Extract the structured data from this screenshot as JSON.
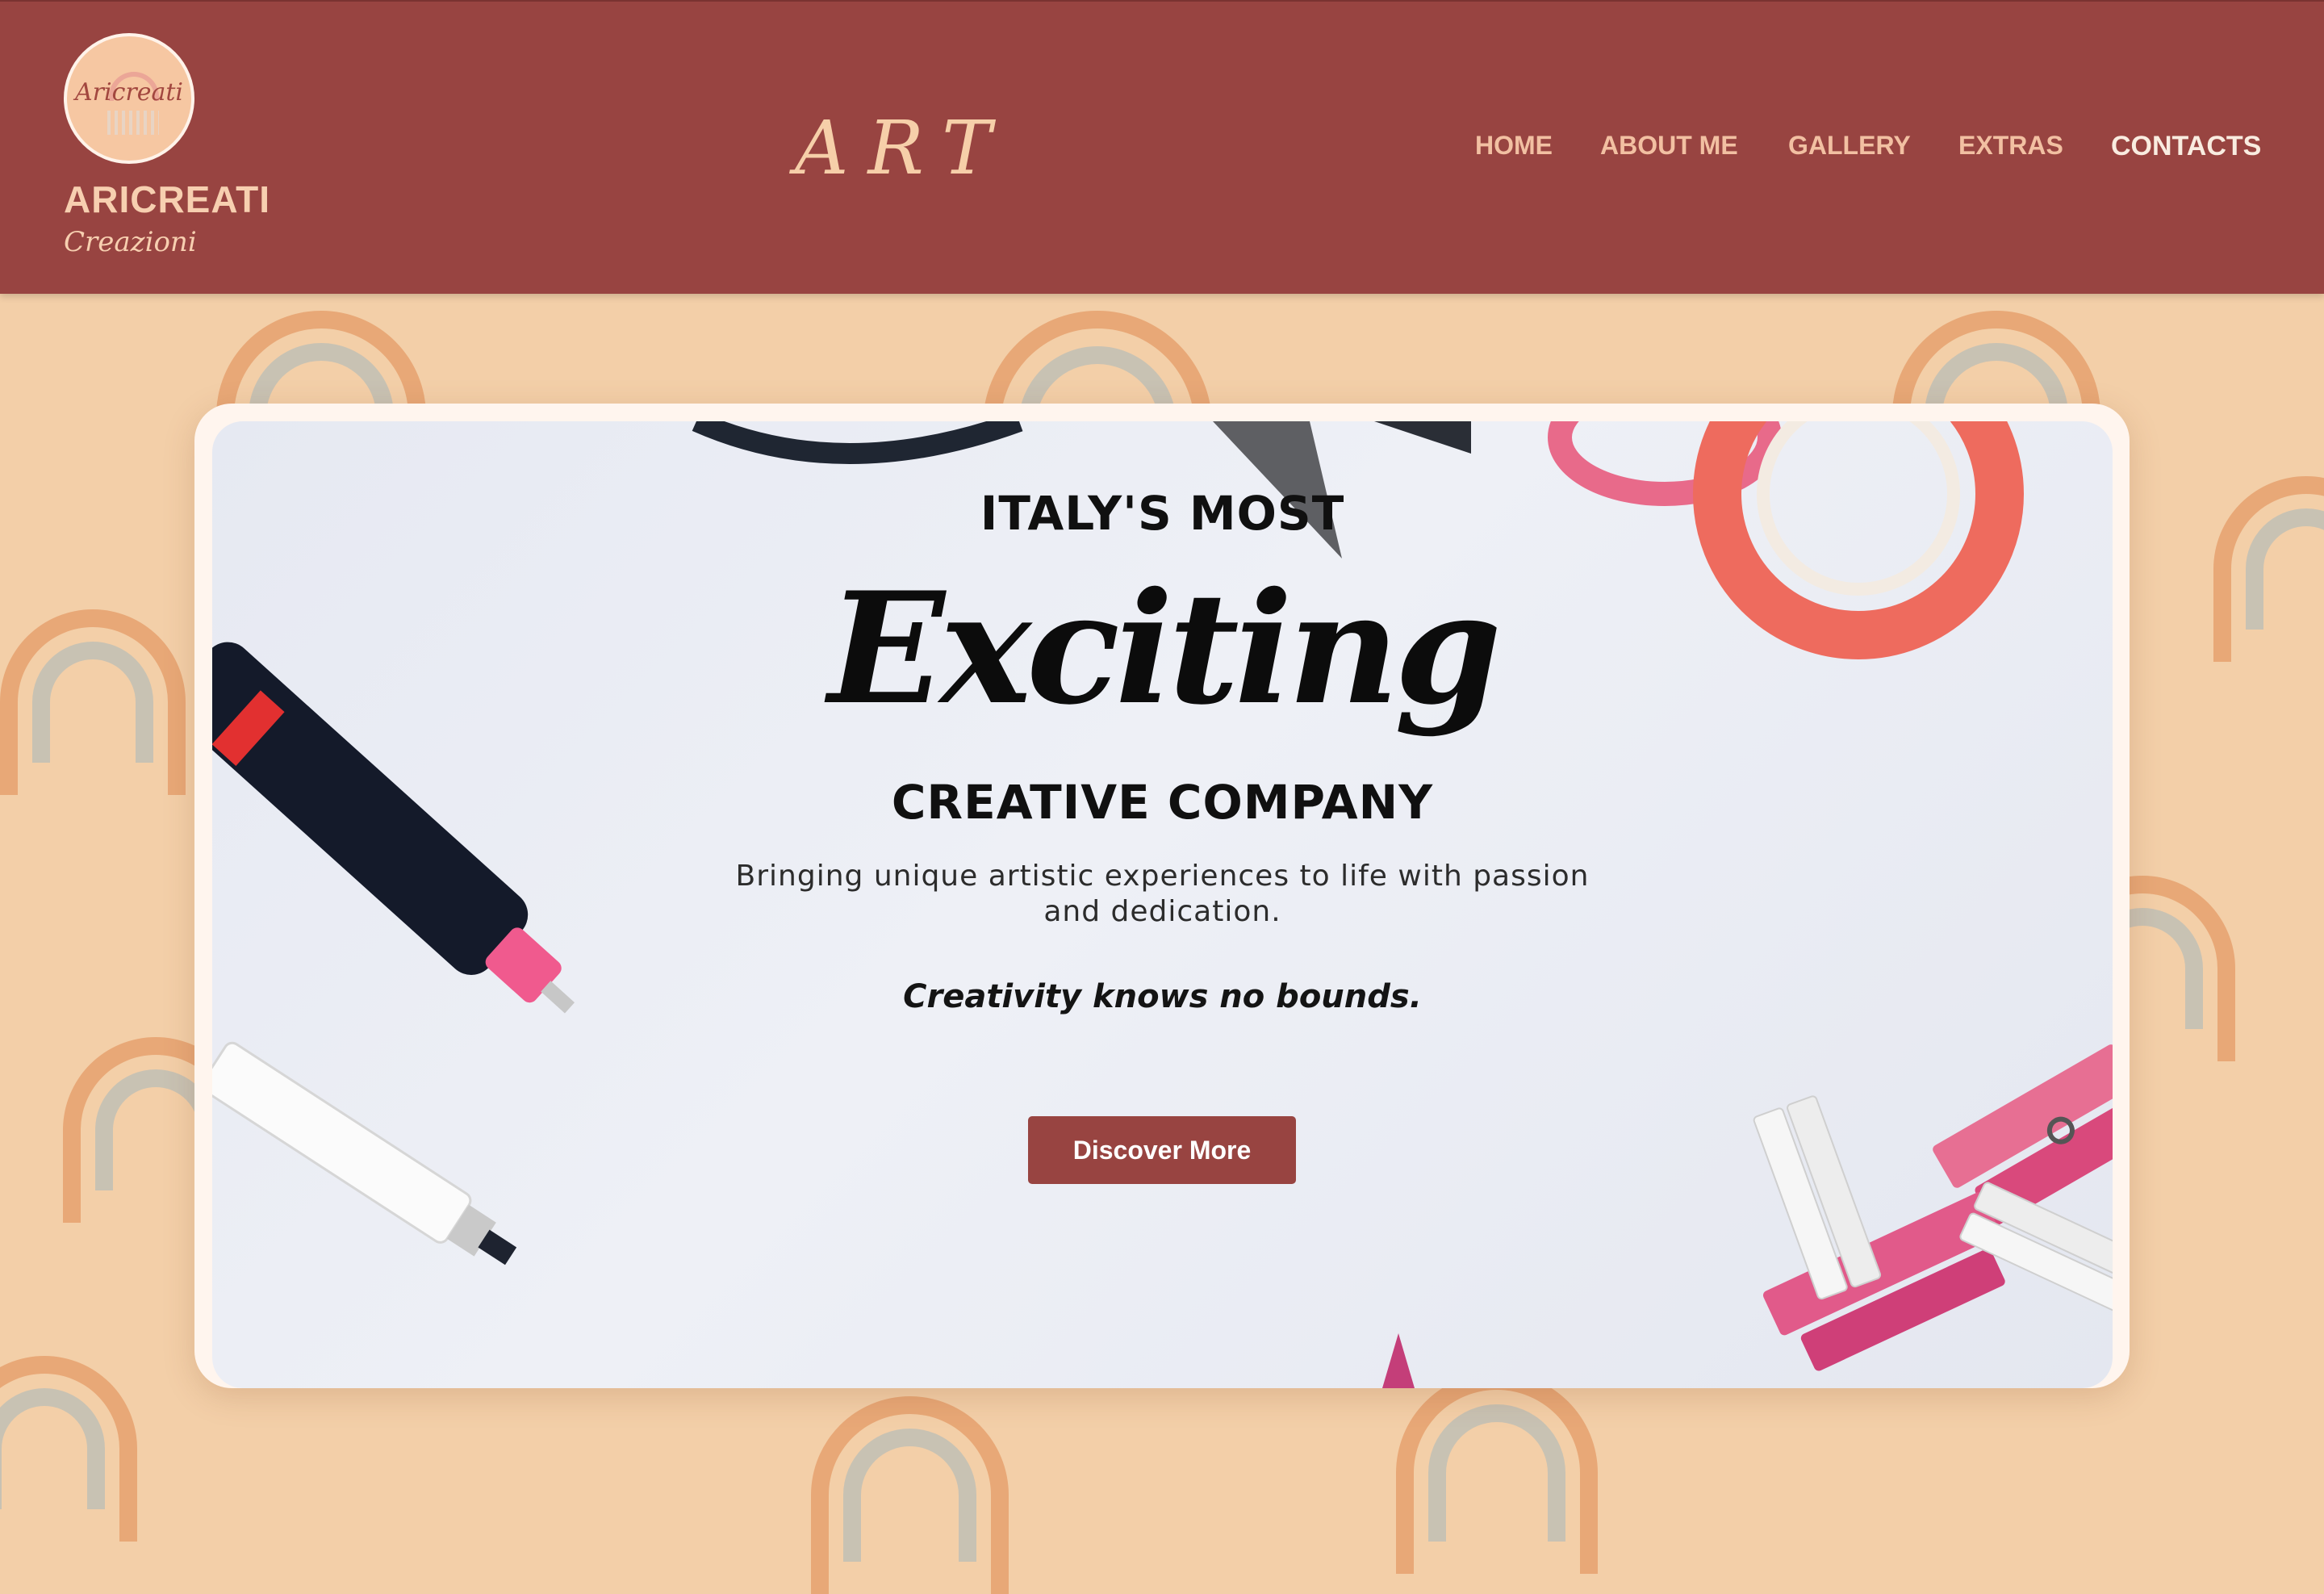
{
  "brand": {
    "badge_text": "Aricreati",
    "name": "ARICREATI",
    "subtitle": "Creazioni"
  },
  "header": {
    "title": "ART",
    "nav": [
      {
        "label": "HOME",
        "active": false
      },
      {
        "label": "ABOUT ME",
        "active": false
      },
      {
        "label": "GALLERY",
        "active": false
      },
      {
        "label": "EXTRAS",
        "active": false
      },
      {
        "label": "CONTACTS",
        "active": true
      }
    ]
  },
  "hero": {
    "line1": "ITALY'S MOST",
    "script": "Exciting",
    "line2": "CREATIVE COMPANY",
    "description": "Bringing unique artistic experiences to life with passion and dedication.",
    "tagline": "Creativity knows no bounds.",
    "cta_label": "Discover More"
  },
  "colors": {
    "header_bg": "#984441",
    "page_bg": "#f3cfa8",
    "nav_text": "#f2c0a2",
    "cta_bg": "#984441"
  },
  "icons": {
    "logo": "rainbow-logo-icon",
    "background_pattern": "rainbow-icon"
  }
}
